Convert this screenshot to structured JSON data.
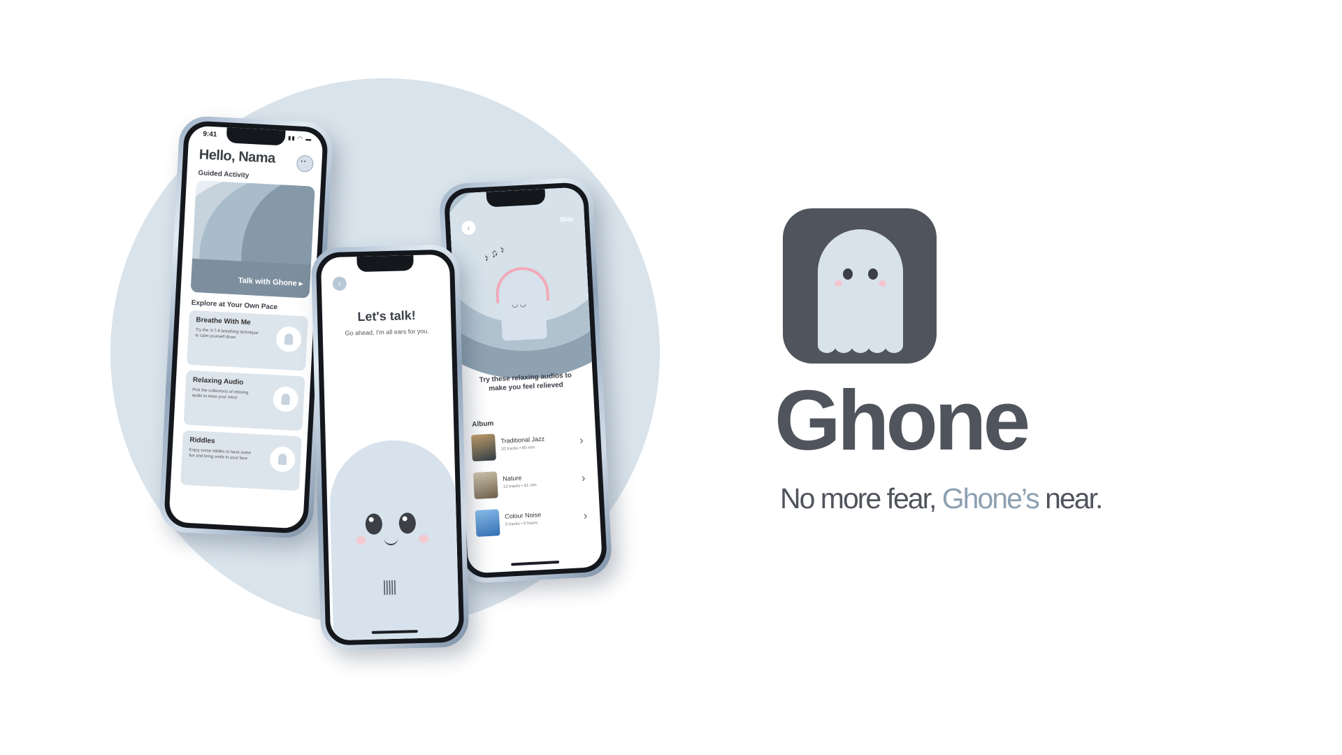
{
  "colors": {
    "background_circle": "#d9e3eb",
    "brand_dark": "#50545c",
    "brand_accent": "#8ca1b2",
    "ghost_fill": "#d8e2ea",
    "cheek_pink": "#f3c6cf"
  },
  "home_screen": {
    "status_time": "9:41",
    "greeting": "Hello, Nama",
    "guided_label": "Guided Activity",
    "guided_button": "Talk with Ghone ▸",
    "explore_label": "Explore at Your Own Pace",
    "cards": [
      {
        "title": "Breathe With Me",
        "desc": "Try the '4-7-8 breathing technique' to calm yourself down"
      },
      {
        "title": "Relaxing Audio",
        "desc": "Pick the collections of relaxing audio to ease your mind"
      },
      {
        "title": "Riddles",
        "desc": "Enjoy some riddles to have some fun and bring smile to your face"
      }
    ]
  },
  "talk_screen": {
    "title": "Let's talk!",
    "subtitle": "Go ahead, I'm all ears for you."
  },
  "audio_screen": {
    "skip": "Skip",
    "prompt": "Try these relaxing audios to make you feel relieved",
    "album_label": "Album",
    "albums": [
      {
        "name": "Traditional Jazz",
        "meta": "20 tracks  •  65 min",
        "color": "#3b4a55"
      },
      {
        "name": "Nature",
        "meta": "13 tracks  •  41 min",
        "color": "#8a7d6a"
      },
      {
        "name": "Colour Noise",
        "meta": "5 tracks  •  6 hours",
        "color": "#4a86c8"
      }
    ]
  },
  "brand": {
    "name": "Ghone",
    "tagline_start": "No more fear, ",
    "tagline_accent": "Ghone’s",
    "tagline_end": " near."
  }
}
